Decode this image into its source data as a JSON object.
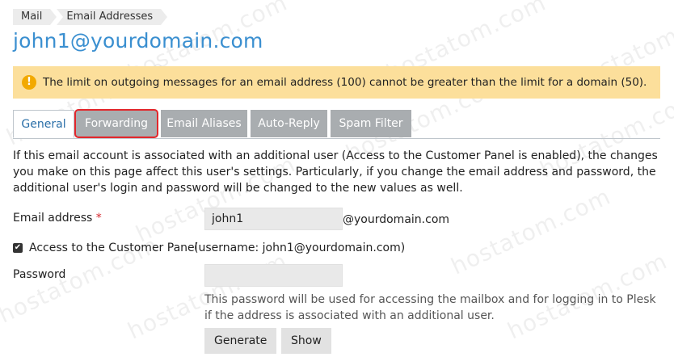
{
  "breadcrumb": [
    "Mail",
    "Email Addresses"
  ],
  "page_title": "john1@yourdomain.com",
  "warning": {
    "text": "The limit on outgoing messages for an email address (100) cannot be greater than the limit for a domain (50).",
    "icon": "exclamation-icon",
    "color": "#fcdf9b"
  },
  "tabs": [
    {
      "label": "General",
      "active": true
    },
    {
      "label": "Forwarding",
      "highlighted": true
    },
    {
      "label": "Email Aliases"
    },
    {
      "label": "Auto-Reply"
    },
    {
      "label": "Spam Filter"
    }
  ],
  "info_text": "If this email account is associated with an additional user (Access to the Customer Panel is enabled), the changes you make on this page affect this user's settings. Particularly, if you change the email address and password, the additional user's login and password will be changed to the new values as well.",
  "form": {
    "email_label": "Email address",
    "email_required": "*",
    "email_value": "john1",
    "email_domain": "@yourdomain.com",
    "access_checked": true,
    "access_label": "Access to the Customer Panel",
    "access_username": "(username: john1@yourdomain.com)",
    "password_label": "Password",
    "password_value": "",
    "password_help": "This password will be used for accessing the mailbox and for logging in to Plesk if the address is associated with an additional user.",
    "generate_label": "Generate",
    "show_label": "Show"
  },
  "watermark": "hostatom.com",
  "colors": {
    "title": "#3a8fd0",
    "tab_inactive": "#a9adb0",
    "highlight": "#e3272c"
  }
}
